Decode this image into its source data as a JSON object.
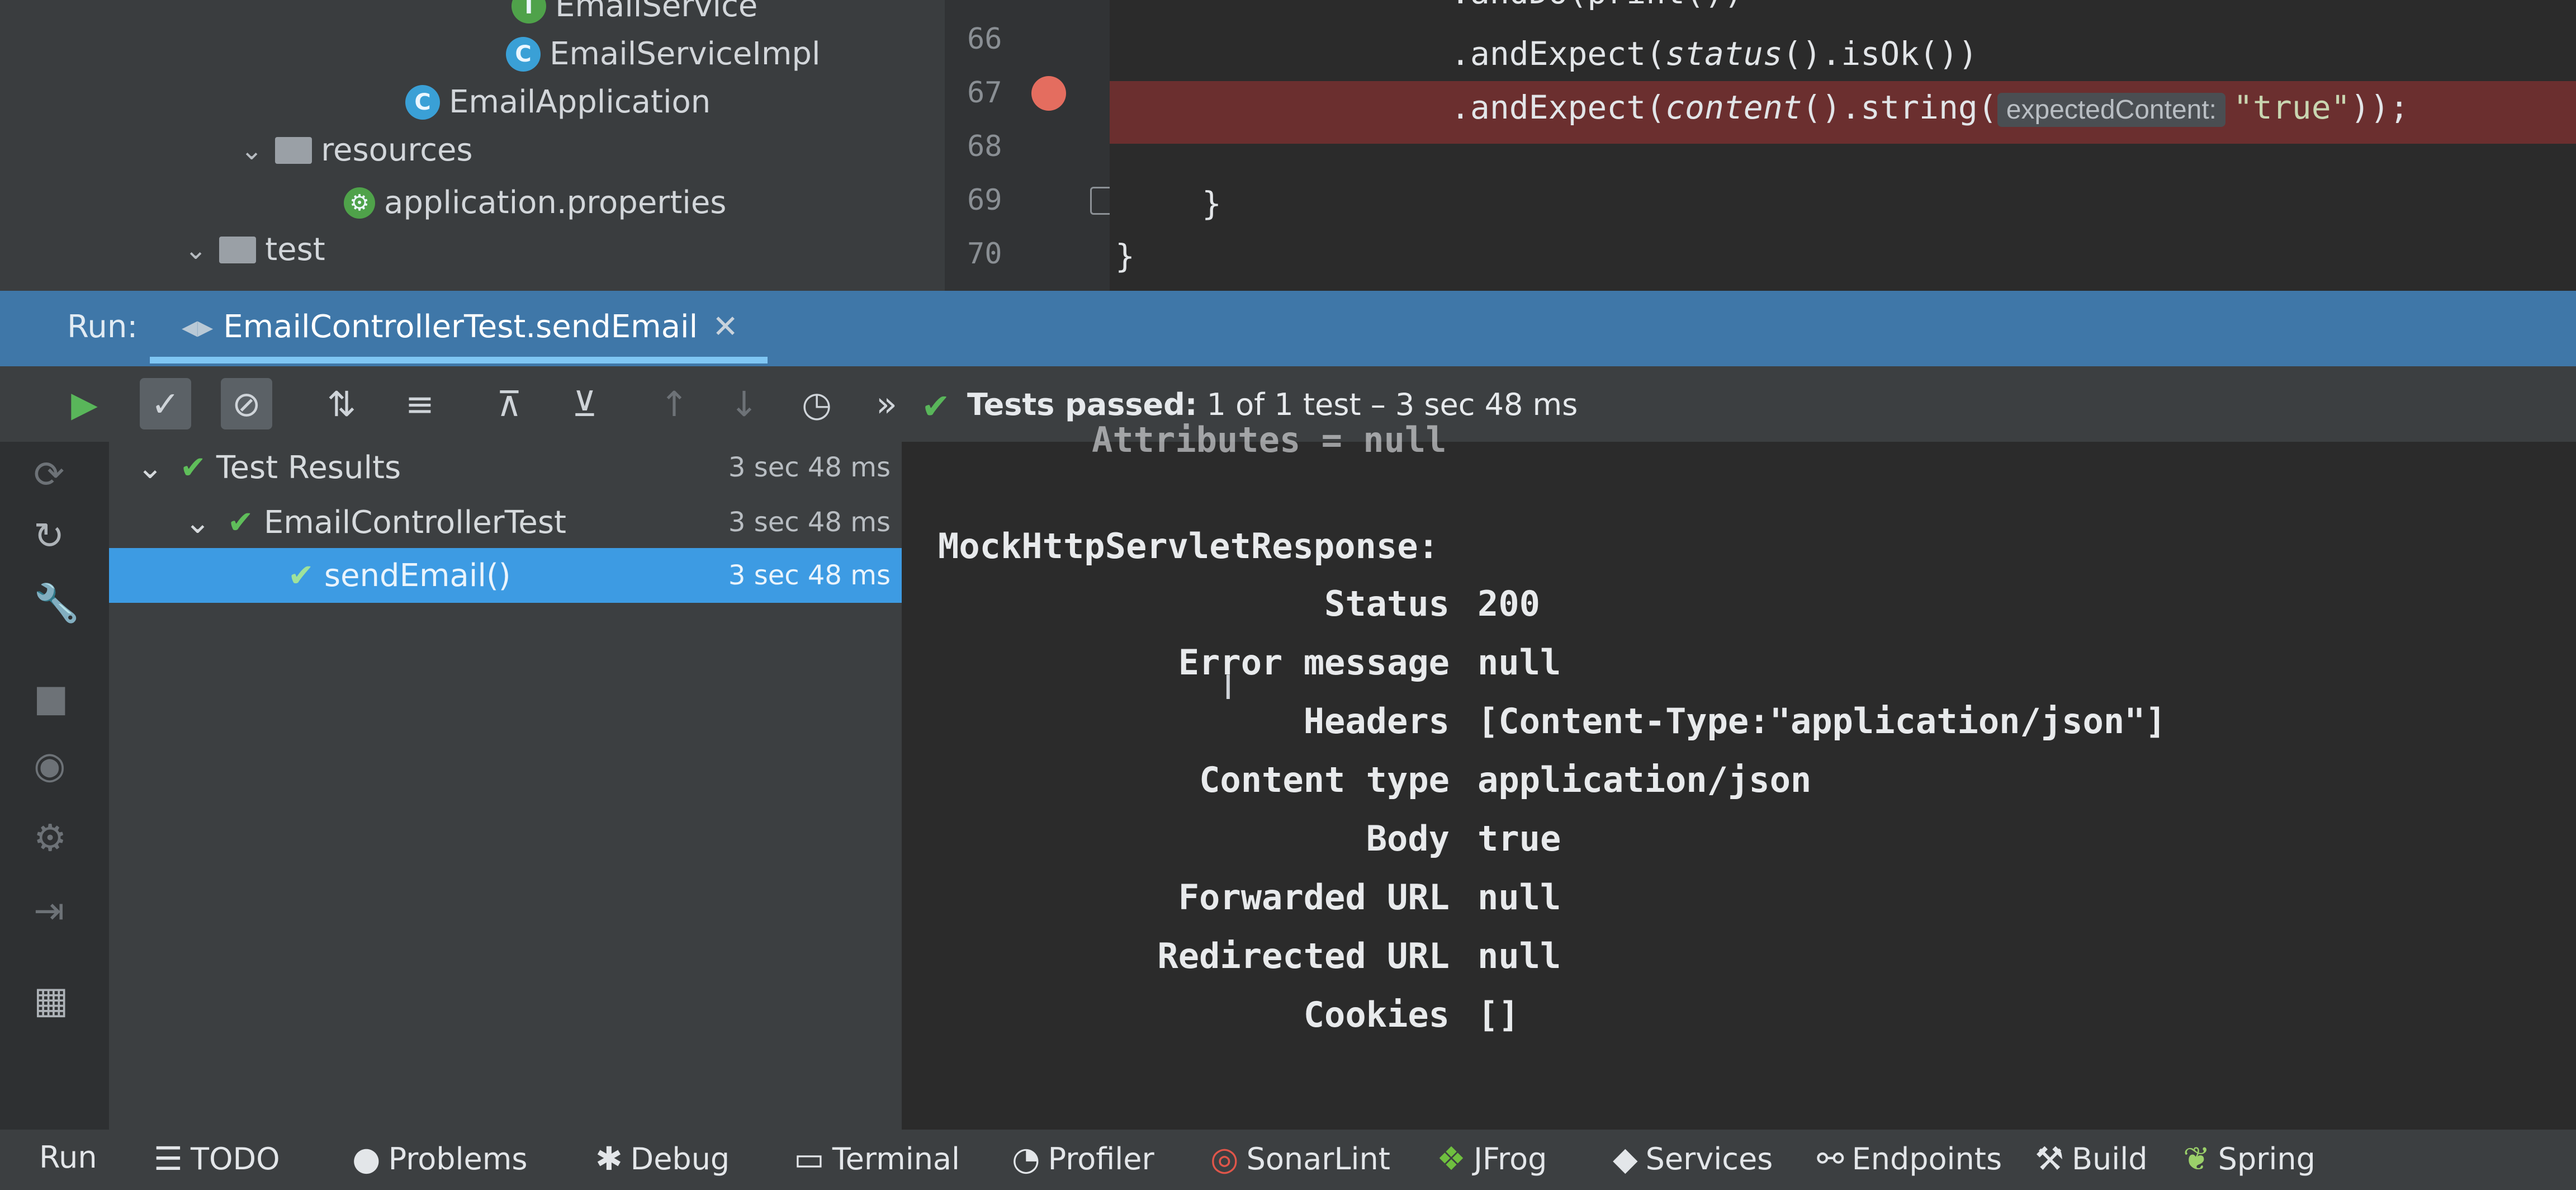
{
  "project_tree": {
    "items": [
      {
        "label": "EmailService",
        "icon": "interface-icon"
      },
      {
        "label": "EmailServiceImpl",
        "icon": "class-icon"
      },
      {
        "label": "EmailApplication",
        "icon": "spring-app-class-icon"
      },
      {
        "label": "resources",
        "icon": "folder-icon"
      },
      {
        "label": "application.properties",
        "icon": "properties-file-icon"
      },
      {
        "label": "test",
        "icon": "folder-icon"
      }
    ]
  },
  "editor": {
    "line_numbers": [
      "66",
      "67",
      "68",
      "69",
      "70"
    ],
    "lines": {
      "l0": ".andDo(print())",
      "l66_prefix": ".andExpect(",
      "l66_fn": "status",
      "l66_suffix": "().isOk())",
      "l67_prefix": ".andExpect(",
      "l67_fn": "content",
      "l67_mid": "().string(",
      "l67_hint": "expectedContent:",
      "l67_arg": "\"true\"",
      "l67_end": "));",
      "l69": "}",
      "l70": "}"
    },
    "breakpoint_line": "67"
  },
  "run_panel": {
    "label": "Run:",
    "tab_title": "EmailControllerTest.sendEmail",
    "status_prefix": "Tests passed:",
    "status_value": "1 of 1 test – 3 sec 48 ms"
  },
  "test_results": [
    {
      "name": "Test Results",
      "duration": "3 sec 48 ms"
    },
    {
      "name": "EmailControllerTest",
      "duration": "3 sec 48 ms"
    },
    {
      "name": "sendEmail()",
      "duration": "3 sec 48 ms"
    }
  ],
  "console": {
    "partial_top": "Attributes = null",
    "heading": "MockHttpServletResponse:",
    "rows": [
      {
        "key": "Status",
        "value": "200"
      },
      {
        "key": "Error message",
        "value": "null"
      },
      {
        "key": "Headers",
        "value": "[Content-Type:\"application/json\"]"
      },
      {
        "key": "Content type",
        "value": "application/json"
      },
      {
        "key": "Body",
        "value": "true"
      },
      {
        "key": "Forwarded URL",
        "value": "null"
      },
      {
        "key": "Redirected URL",
        "value": "null"
      },
      {
        "key": "Cookies",
        "value": "[]"
      }
    ]
  },
  "bottom_tabs": [
    "Run",
    "TODO",
    "Problems",
    "Debug",
    "Terminal",
    "Profiler",
    "SonarLint",
    "JFrog",
    "Services",
    "Endpoints",
    "Build",
    "Spring"
  ],
  "colors": {
    "accent_blue": "#3f77a8",
    "selected_row": "#3d9be3",
    "pass_green": "#59b65a",
    "error_line": "#6b2f2f",
    "breakpoint": "#e46d5f"
  }
}
